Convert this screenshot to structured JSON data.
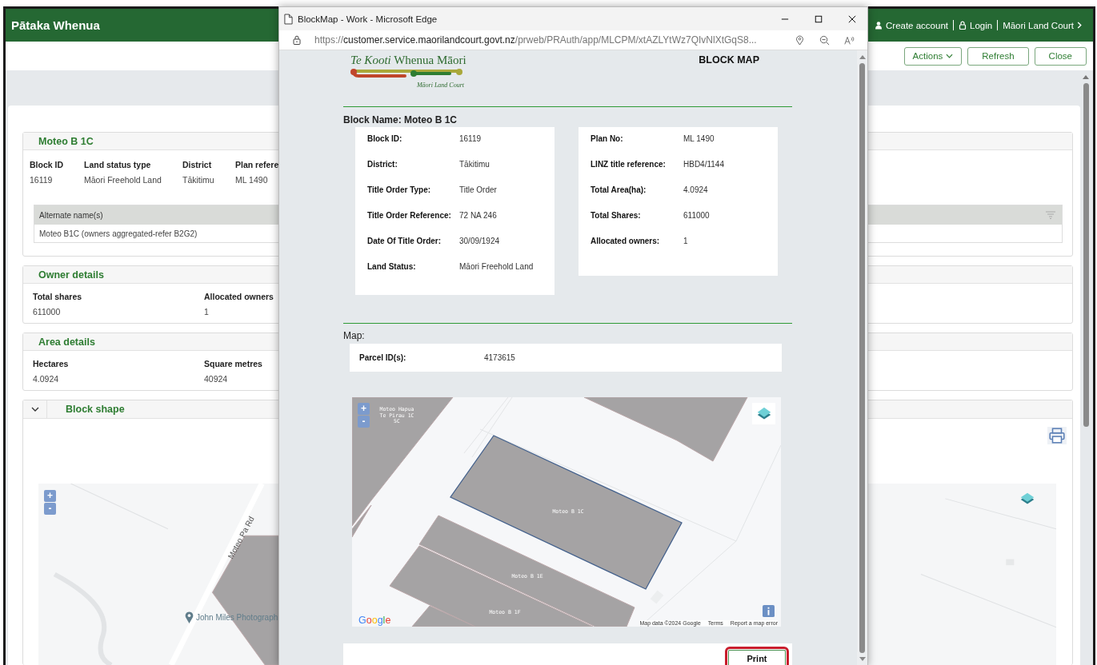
{
  "app": {
    "title": "Pātaka Whenua",
    "nav": [
      {
        "kind": "user",
        "label": "Create account"
      },
      {
        "kind": "lock",
        "label": "Login"
      },
      {
        "kind": "link",
        "label": "Māori Land Court"
      }
    ]
  },
  "toolbar": {
    "buttons": [
      {
        "kind": "menu",
        "label": "Actions"
      },
      {
        "kind": "plain",
        "label": "Refresh"
      },
      {
        "kind": "plain",
        "label": "Close"
      }
    ]
  },
  "block_section": {
    "title": "Moteo B 1C",
    "fields": [
      {
        "label": "Block ID",
        "value": "16119"
      },
      {
        "label": "Land status type",
        "value": "Māori Freehold Land"
      },
      {
        "label": "District",
        "value": "Tākitimu"
      },
      {
        "label": "Plan refere",
        "value": "ML 1490"
      }
    ],
    "alternate_names": {
      "column": "Alternate name(s)",
      "rows": [
        "Moteo B1C (owners aggregated-refer B2G2)"
      ]
    }
  },
  "owner_section": {
    "title": "Owner details",
    "fields": [
      {
        "label": "Total shares",
        "value": "611000"
      },
      {
        "label": "Allocated owners",
        "value": "1"
      }
    ]
  },
  "area_section": {
    "title": "Area details",
    "fields": [
      {
        "label": "Hectares",
        "value": "4.0924"
      },
      {
        "label": "Square metres",
        "value": "40924"
      }
    ]
  },
  "shape_section": {
    "title": "Block shape",
    "expanded": true,
    "map": {
      "zoom_in": "+",
      "zoom_out": "-",
      "road": "Moteo Pa Rd",
      "place": "John Miles Photograph"
    }
  },
  "popup": {
    "title": "BlockMap - Work - Microsoft Edge",
    "url": {
      "scheme": "https://",
      "host": "customer.service.maorilandcourt.govt.nz",
      "path": "/prweb/PRAuth/app/MLCPM/xtAZLYtWz7QIvNlXtGqS8..."
    },
    "logo": {
      "name": "*Te Kooti* Whenua Māori",
      "subtitle": "Māori Land Court"
    },
    "heading": "BLOCK MAP",
    "block_name": "Block Name: Moteo B 1C",
    "left_fields": [
      {
        "label": "Block ID:",
        "value": "16119"
      },
      {
        "label": "District:",
        "value": "Tākitimu"
      },
      {
        "label": "Title Order Type:",
        "value": "Title Order"
      },
      {
        "label": "Title Order Reference:",
        "value": "72 NA 246"
      },
      {
        "label": "Date Of Title Order:",
        "value": "30/09/1924"
      },
      {
        "label": "Land Status:",
        "value": "Māori Freehold Land"
      }
    ],
    "right_fields": [
      {
        "label": "Plan No:",
        "value": "ML 1490"
      },
      {
        "label": "LINZ title reference:",
        "value": "HBD4/1144"
      },
      {
        "label": "Total Area(ha):",
        "value": "4.0924"
      },
      {
        "label": "Total Shares:",
        "value": "611000"
      },
      {
        "label": "Allocated owners:",
        "value": "1"
      }
    ],
    "map_heading": "Map:",
    "parcel": {
      "label": "Parcel ID(s):",
      "value": "4173615"
    },
    "map": {
      "zoom_in": "+",
      "zoom_out": "-",
      "parcels": [
        {
          "lines": [
            "Moteo B 1C"
          ],
          "selected": true
        },
        {
          "lines": [
            "Moteo B 1E"
          ],
          "selected": false
        },
        {
          "lines": [
            "Moteo B 1F"
          ],
          "selected": false
        },
        {
          "lines": [
            "Moteo Hapua",
            "Te Pirau 1C",
            "5C"
          ],
          "selected": false
        }
      ],
      "logo": "Google",
      "attribution": [
        "Map data ©2024 Google",
        "Terms",
        "Report a map error"
      ]
    },
    "print": {
      "label": "Print",
      "highlighted": true
    }
  }
}
